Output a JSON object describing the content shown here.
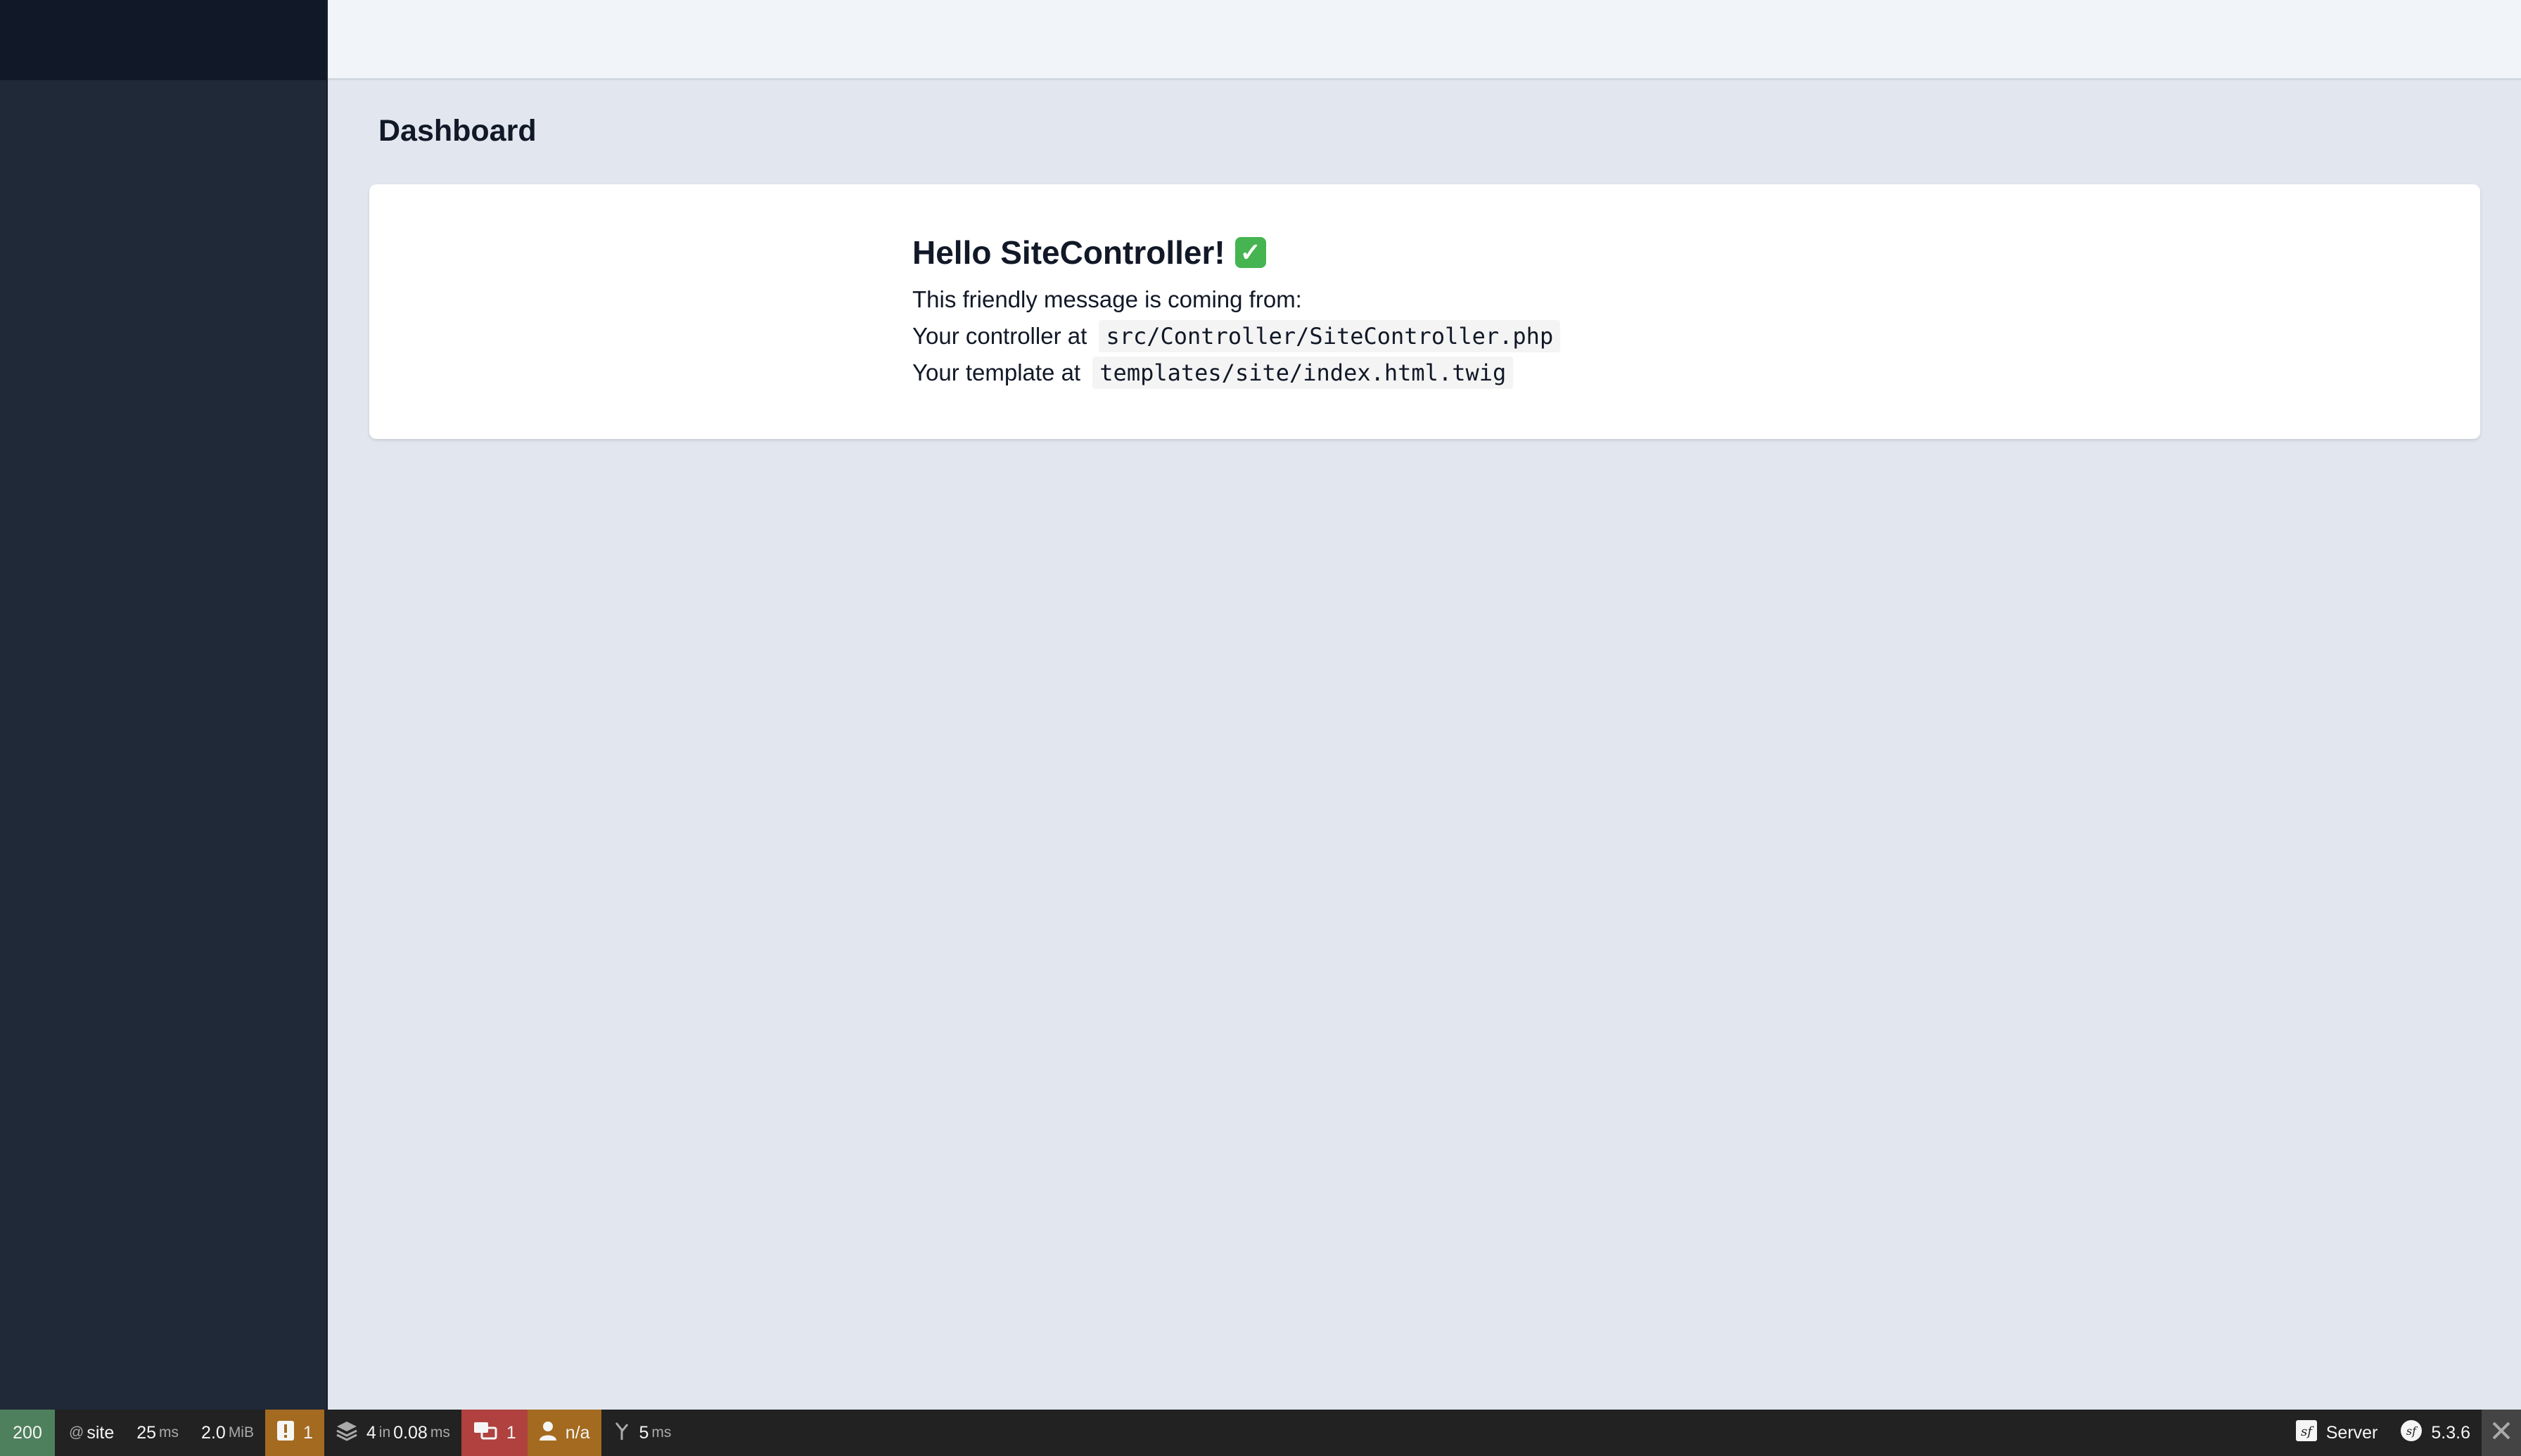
{
  "page": {
    "title": "Dashboard"
  },
  "card": {
    "heading": "Hello SiteController!",
    "check_glyph": "✓",
    "intro": "This friendly message is coming from:",
    "controller_label": "Your controller at",
    "controller_path": "src/Controller/SiteController.php",
    "template_label": "Your template at",
    "template_path": "templates/site/index.html.twig"
  },
  "toolbar": {
    "status_code": "200",
    "route_prefix": "@",
    "route": "site",
    "time_value": "25",
    "time_unit": "ms",
    "memory_value": "2.0",
    "memory_unit": "MiB",
    "logs_count": "1",
    "twig_count": "4",
    "twig_in": "in",
    "twig_time": "0.08",
    "twig_unit": "ms",
    "translation_count": "1",
    "user": "n/a",
    "perf_value": "5",
    "perf_unit": "ms",
    "server_label": "Server",
    "version": "5.3.6"
  },
  "colors": {
    "sidebar": "#1f2937",
    "sidebar_brand": "#111827",
    "topbar": "#f1f4f8",
    "content_bg": "#e2e7ef",
    "toolbar_bg": "#222222",
    "status_ok": "#4f805d",
    "warning": "#a46a1f",
    "error": "#b0413e"
  },
  "icons": {
    "logs": "exclamation-icon",
    "twig": "layers-icon",
    "translation": "translation-icon",
    "user": "user-icon",
    "performance": "performance-icon",
    "symfony": "symfony-logo-icon",
    "close": "close-icon"
  }
}
